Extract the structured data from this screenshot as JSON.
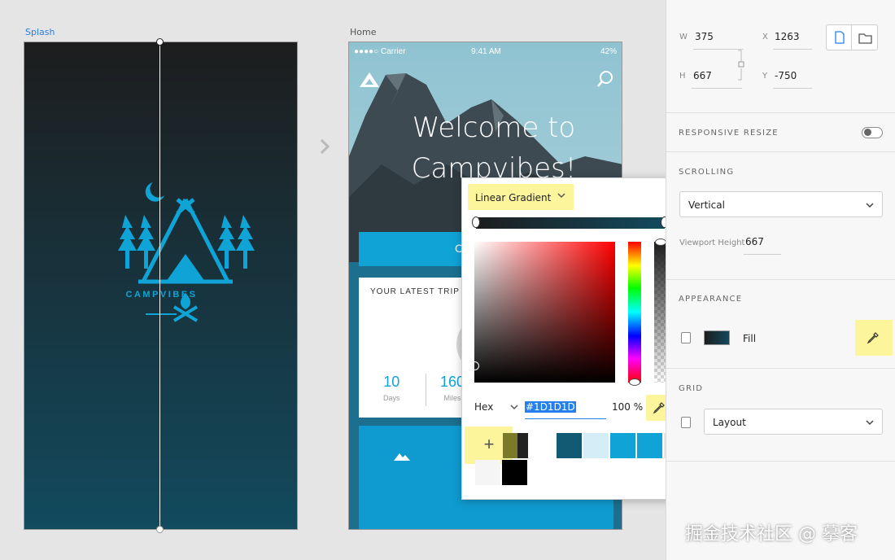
{
  "canvas": {
    "artboards": [
      {
        "label": "Splash"
      },
      {
        "label": "Home"
      }
    ]
  },
  "splash": {
    "brand": "CAMPVIBES"
  },
  "home": {
    "status": {
      "carrier": "●●●●○ Carrier",
      "time": "9:41 AM",
      "battery": "42%"
    },
    "welcome": "Welcome to Campvibes!",
    "cta_partial": "C",
    "trip_card": {
      "title": "YOUR LATEST TRIP",
      "stats": [
        {
          "value": "10",
          "unit": "Days"
        },
        {
          "value": "160",
          "unit": "Miles"
        }
      ]
    }
  },
  "color_picker": {
    "fill_type": "Linear Gradient",
    "gradient_stops": [
      "#1D1D1D",
      "#124A5E"
    ],
    "mode": "Hex",
    "hex": "#1D1D1D",
    "opacity": "100 %",
    "swatches": [
      "#7a7a28",
      "#222222",
      "#125a73",
      "#d4eef8",
      "#0fa3d6",
      "#0fa3d6",
      "#e6e6e6",
      "#f5f5f5",
      "#000000"
    ]
  },
  "panel": {
    "dims": {
      "w_label": "W",
      "w": "375",
      "x_label": "X",
      "x": "1263",
      "h_label": "H",
      "h": "667",
      "y_label": "Y",
      "y": "-750"
    },
    "responsive_resize": "RESPONSIVE RESIZE",
    "scrolling": {
      "title": "SCROLLING",
      "value": "Vertical",
      "viewport_label": "Viewport Height",
      "viewport_value": "667"
    },
    "appearance": {
      "title": "APPEARANCE",
      "fill_label": "Fill"
    },
    "grid": {
      "title": "GRID",
      "value": "Layout"
    }
  },
  "watermark": "掘金技术社区 @ 摹客"
}
